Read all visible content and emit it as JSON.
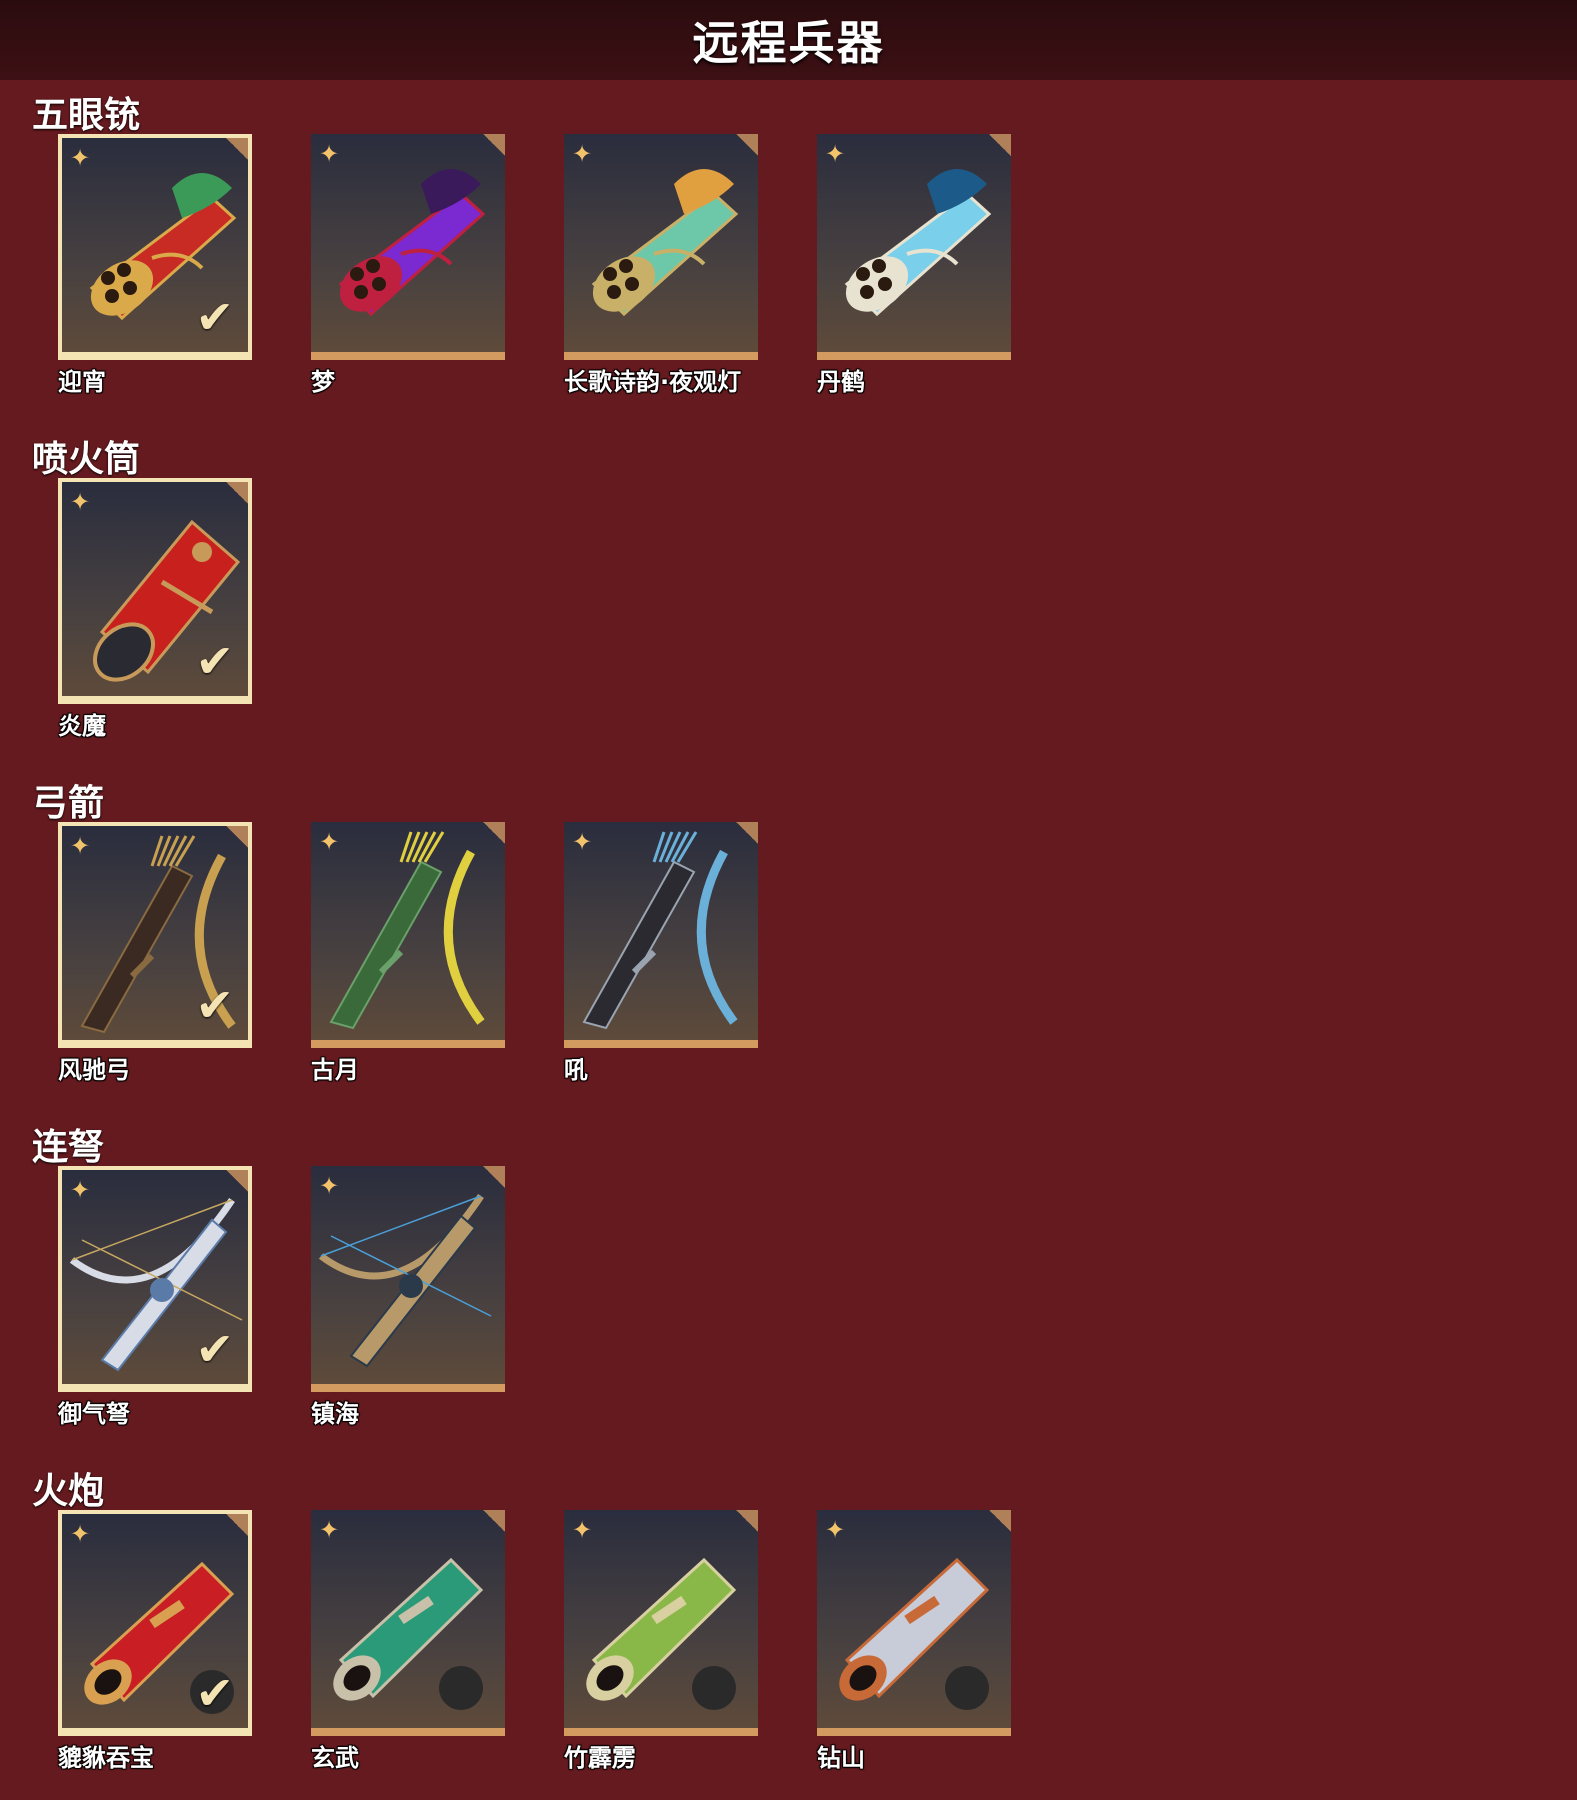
{
  "header": {
    "title": "远程兵器"
  },
  "sections": [
    {
      "title": "五眼铳",
      "items": [
        {
          "name": "迎宵",
          "selected": true,
          "colors": [
            "#c82a24",
            "#3c9a58",
            "#d9a94a"
          ],
          "shape": "gun"
        },
        {
          "name": "梦",
          "selected": false,
          "colors": [
            "#7a2ad0",
            "#3a1a5a",
            "#c02040"
          ],
          "shape": "gun"
        },
        {
          "name": "长歌诗韵·夜观灯",
          "selected": false,
          "colors": [
            "#6cc8a8",
            "#e0a040",
            "#c8b068"
          ],
          "shape": "gun"
        },
        {
          "name": "丹鹤",
          "selected": false,
          "colors": [
            "#7ad0ea",
            "#1c5a8a",
            "#e8e2d0"
          ],
          "shape": "gun"
        }
      ]
    },
    {
      "title": "喷火筒",
      "items": [
        {
          "name": "炎魔",
          "selected": true,
          "colors": [
            "#c8201c",
            "#2a2a32",
            "#c89a5a"
          ],
          "shape": "tube"
        }
      ]
    },
    {
      "title": "弓箭",
      "items": [
        {
          "name": "风驰弓",
          "selected": true,
          "colors": [
            "#3a2a22",
            "#c8a050",
            "#8a6a40"
          ],
          "shape": "bow"
        },
        {
          "name": "古月",
          "selected": false,
          "colors": [
            "#3a6a3a",
            "#e0d040",
            "#6aa06a"
          ],
          "shape": "bow"
        },
        {
          "name": "吼",
          "selected": false,
          "colors": [
            "#2a2a30",
            "#6ab0d8",
            "#9aa4b0"
          ],
          "shape": "bow"
        }
      ]
    },
    {
      "title": "连弩",
      "items": [
        {
          "name": "御气弩",
          "selected": true,
          "colors": [
            "#d8dce6",
            "#5a7aa8",
            "#c8a860"
          ],
          "shape": "crossbow"
        },
        {
          "name": "镇海",
          "selected": false,
          "colors": [
            "#b89a6a",
            "#2a3a4a",
            "#4aa0d8"
          ],
          "shape": "crossbow"
        }
      ]
    },
    {
      "title": "火炮",
      "items": [
        {
          "name": "貔貅吞宝",
          "selected": true,
          "colors": [
            "#c81e24",
            "#d8a050",
            "#2a2a2a"
          ],
          "shape": "cannon"
        },
        {
          "name": "玄武",
          "selected": false,
          "colors": [
            "#2a9a78",
            "#c8c0a8",
            "#2a2a2a"
          ],
          "shape": "cannon"
        },
        {
          "name": "竹霹雳",
          "selected": false,
          "colors": [
            "#8ab848",
            "#d8d0a0",
            "#2a2a2a"
          ],
          "shape": "cannon"
        },
        {
          "name": "钻山",
          "selected": false,
          "colors": [
            "#c8ccd8",
            "#c86a38",
            "#2a2a2a"
          ],
          "shape": "cannon"
        }
      ]
    }
  ],
  "icons": {
    "rarity": "four-point-star-icon",
    "equipped": "checkmark-icon"
  },
  "symbols": {
    "star": "✦",
    "check": "✔"
  }
}
